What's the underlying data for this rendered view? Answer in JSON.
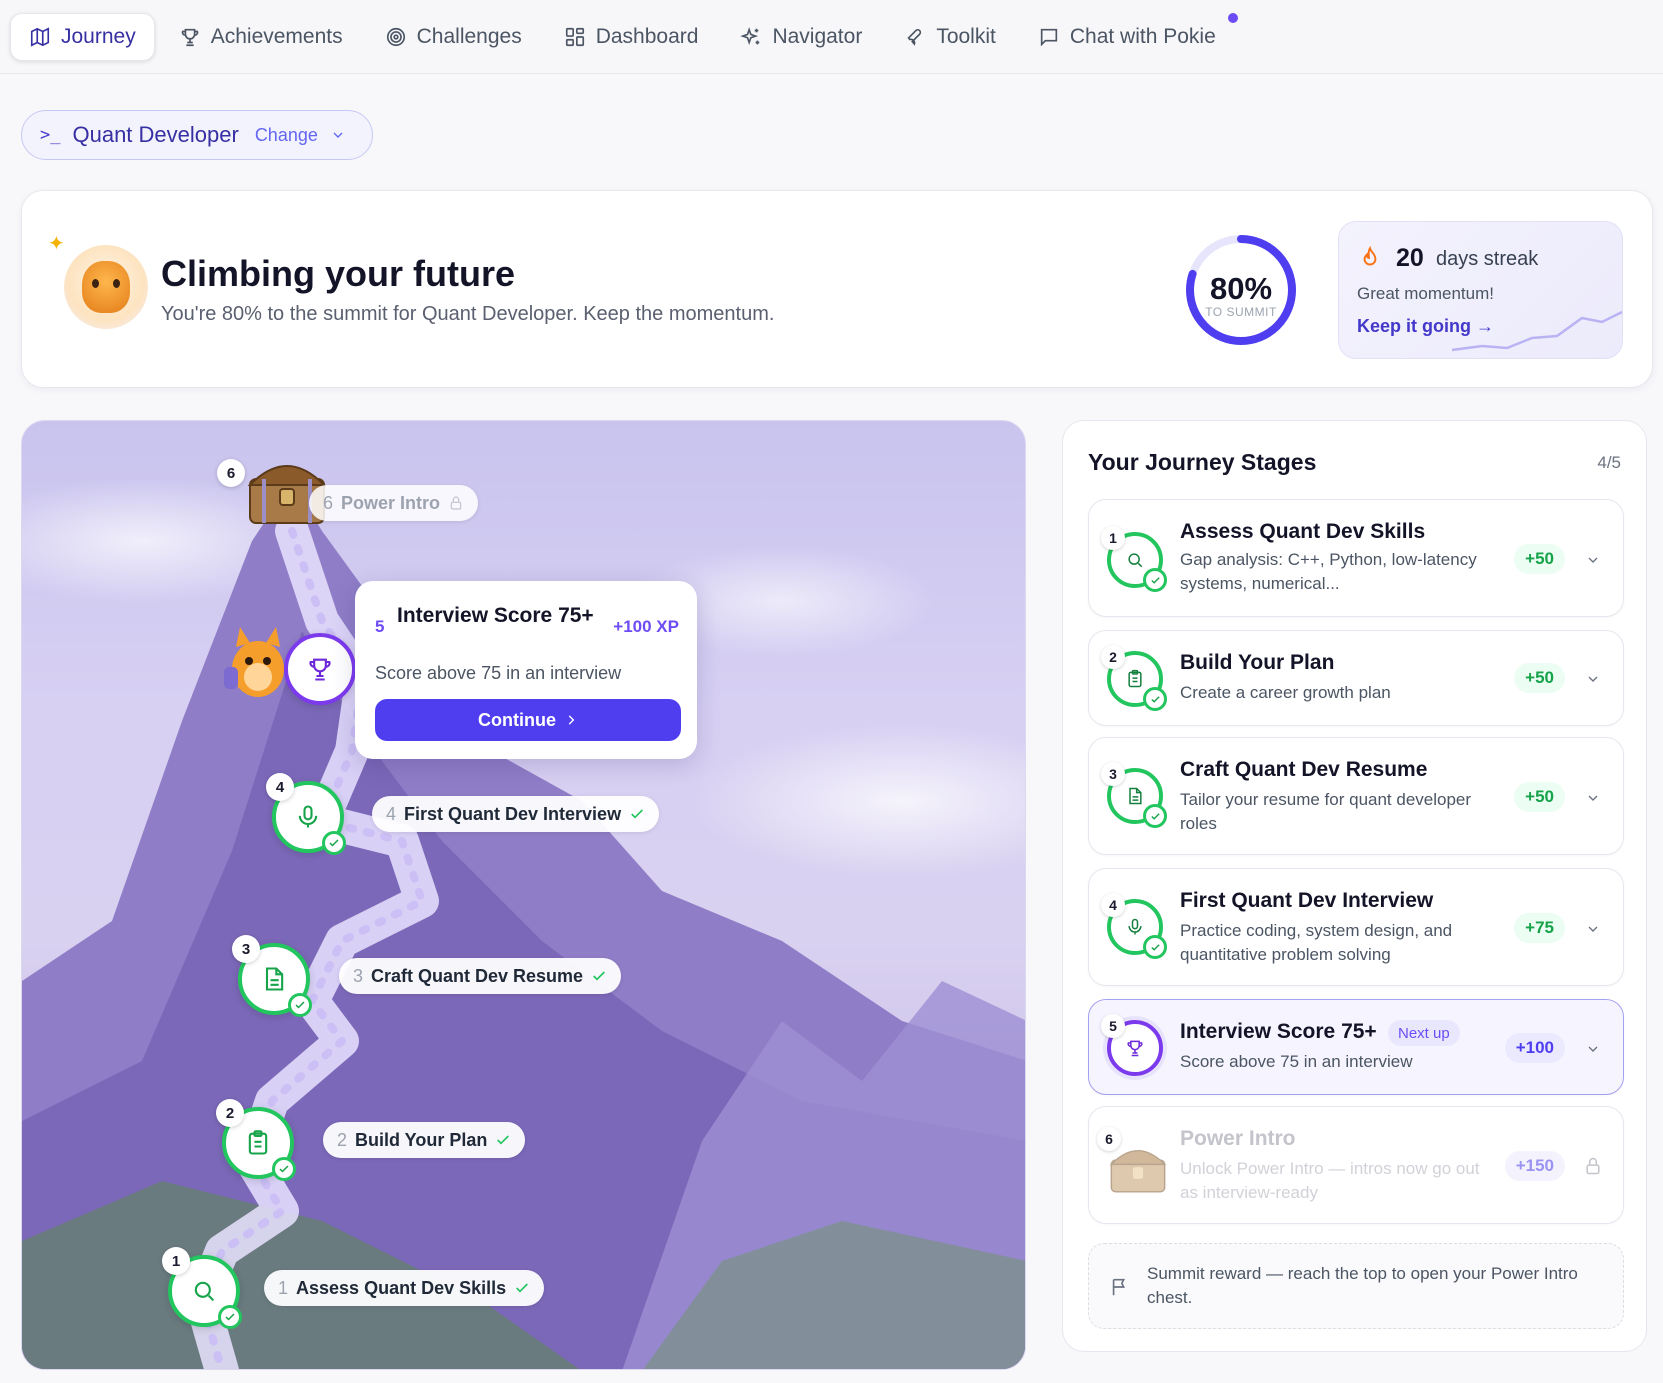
{
  "nav": {
    "items": [
      {
        "label": "Journey",
        "icon": "map-icon",
        "active": true
      },
      {
        "label": "Achievements",
        "icon": "trophy-icon"
      },
      {
        "label": "Challenges",
        "icon": "target-icon"
      },
      {
        "label": "Dashboard",
        "icon": "grid-icon"
      },
      {
        "label": "Navigator",
        "icon": "sparkles-icon"
      },
      {
        "label": "Toolkit",
        "icon": "wrench-icon"
      },
      {
        "label": "Chat with Pokie",
        "icon": "chat-icon",
        "notification": true
      }
    ]
  },
  "role": {
    "prompt": ">_",
    "name": "Quant Developer",
    "change_label": "Change"
  },
  "hero": {
    "title": "Climbing your future",
    "subtitle": "You're 80% to the summit for Quant Developer. Keep the momentum.",
    "progress_percent": 80,
    "progress_label": "80%",
    "progress_caption": "TO SUMMIT"
  },
  "streak": {
    "count": "20",
    "unit": "days streak",
    "message": "Great momentum!",
    "cta": "Keep it going →"
  },
  "map": {
    "popup": {
      "number": "5",
      "title": "Interview Score 75+",
      "xp": "+100 XP",
      "description": "Score above 75 in an interview",
      "button": "Continue"
    },
    "pills": [
      {
        "n": "1",
        "label": "Assess Quant Dev Skills"
      },
      {
        "n": "2",
        "label": "Build Your Plan"
      },
      {
        "n": "3",
        "label": "Craft Quant Dev Resume"
      },
      {
        "n": "4",
        "label": "First Quant Dev Interview"
      },
      {
        "n": "6",
        "label": "Power Intro"
      }
    ],
    "node_numbers": [
      "1",
      "2",
      "3",
      "4",
      "5",
      "6"
    ]
  },
  "stages": {
    "title": "Your Journey Stages",
    "count": "4/5",
    "items": [
      {
        "n": "1",
        "title": "Assess Quant Dev Skills",
        "desc": "Gap analysis: C++, Python, low-latency systems, numerical...",
        "xp": "+50",
        "status": "done"
      },
      {
        "n": "2",
        "title": "Build Your Plan",
        "desc": "Create a career growth plan",
        "xp": "+50",
        "status": "done"
      },
      {
        "n": "3",
        "title": "Craft Quant Dev Resume",
        "desc": "Tailor your resume for quant developer roles",
        "xp": "+50",
        "status": "done"
      },
      {
        "n": "4",
        "title": "First Quant Dev Interview",
        "desc": "Practice coding, system design, and quantitative problem solving",
        "xp": "+75",
        "status": "done"
      },
      {
        "n": "5",
        "title": "Interview Score 75+",
        "badge": "Next up",
        "desc": "Score above 75 in an interview",
        "xp": "+100",
        "status": "next"
      },
      {
        "n": "6",
        "title": "Power Intro",
        "desc": "Unlock Power Intro — intros now go out as interview-ready",
        "xp": "+150",
        "status": "locked"
      }
    ],
    "summit": "Summit reward — reach the top to open your Power Intro chest."
  },
  "colors": {
    "accent": "#4f3ef0",
    "done": "#22c55e",
    "next": "#7c3aed"
  }
}
